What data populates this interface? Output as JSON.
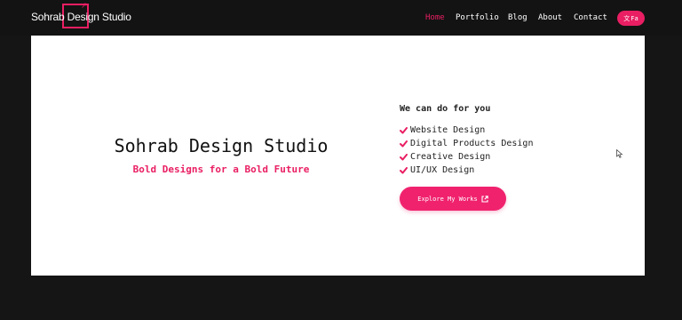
{
  "brand": {
    "name": "Sohrab Design Studio",
    "accent_color": "#e91e63",
    "logo_icon": "external-link-arrow-icon"
  },
  "nav": {
    "items": [
      {
        "label": "Home",
        "active": true
      },
      {
        "label": "Portfolio",
        "active": false
      },
      {
        "label": "Blog",
        "active": false
      },
      {
        "label": "About",
        "active": false
      },
      {
        "label": "Contact",
        "active": false
      }
    ],
    "lang_button": {
      "icon": "translate-icon",
      "label": "Fa"
    }
  },
  "hero": {
    "title": "Sohrab Design Studio",
    "subtitle": "Bold Designs for a Bold Future"
  },
  "services": {
    "heading": "We can do for you",
    "icon": "check-icon",
    "items": [
      "Website Design",
      "Digital Products Design",
      "Creative Design",
      "UI/UX Design"
    ]
  },
  "cta": {
    "label": "Explore My Works",
    "icon": "external-link-icon"
  }
}
